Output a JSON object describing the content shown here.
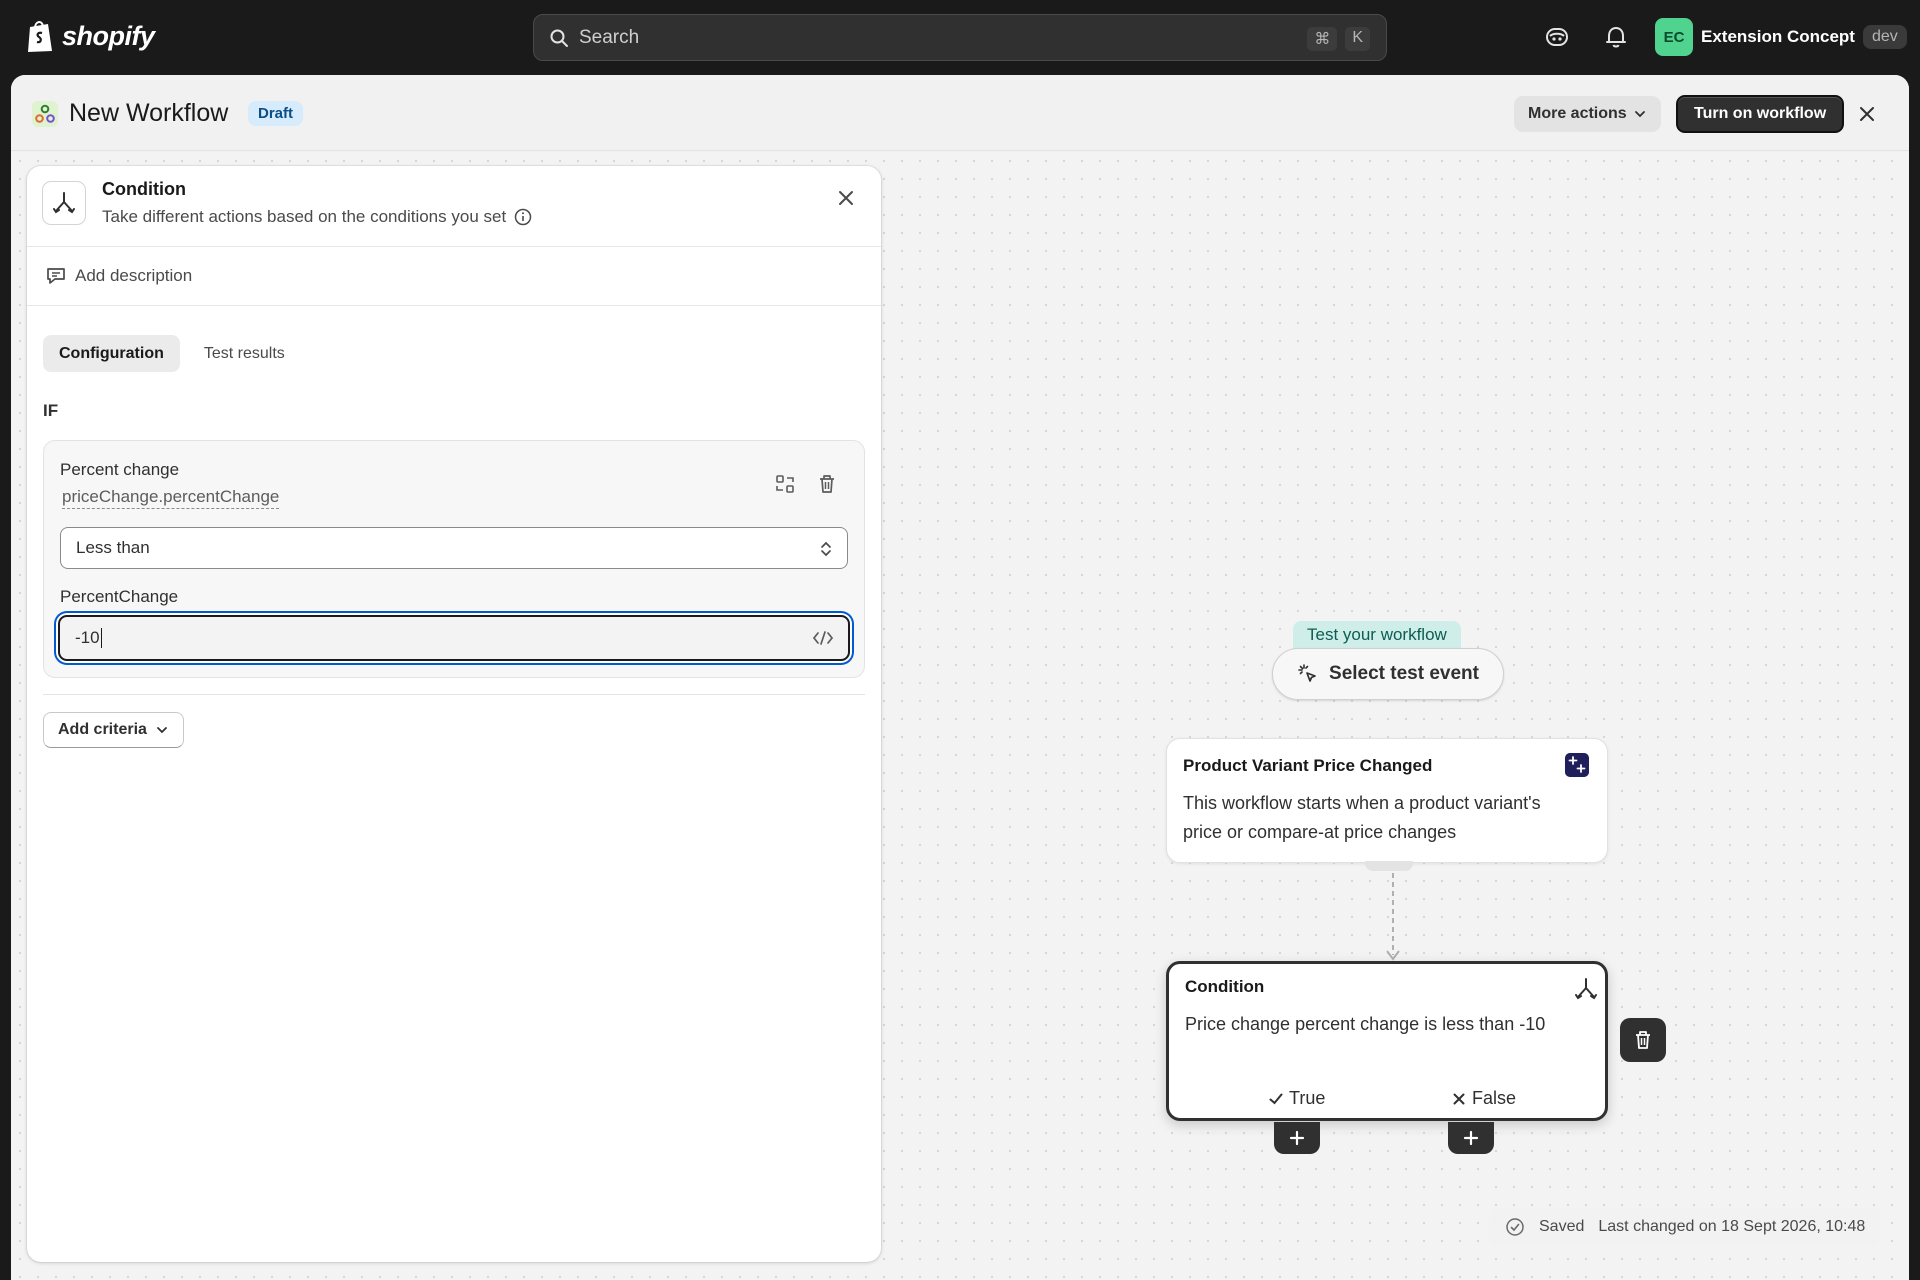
{
  "topbar": {
    "brand": "shopify",
    "search_placeholder": "Search",
    "shortcut_cmd": "⌘",
    "shortcut_key": "K",
    "store_initials": "EC",
    "store_name": "Extension Concept",
    "store_env": "dev"
  },
  "header": {
    "title": "New Workflow",
    "status_badge": "Draft",
    "more_actions_label": "More actions",
    "turn_on_label": "Turn on workflow"
  },
  "panel": {
    "title": "Condition",
    "subtitle": "Take different actions based on the conditions you set",
    "add_description": "Add description",
    "tabs": [
      {
        "label": "Configuration",
        "active": true
      },
      {
        "label": "Test results",
        "active": false
      }
    ],
    "if_label": "IF",
    "criteria": {
      "name": "Percent change",
      "path": "priceChange.percentChange",
      "operator": "Less than",
      "field_label": "PercentChange",
      "value": "-10"
    },
    "add_criteria_label": "Add criteria"
  },
  "canvas": {
    "test_tag": "Test your workflow",
    "test_button": "Select test event",
    "trigger": {
      "title": "Product Variant Price Changed",
      "text": "This workflow starts when a product variant's price or compare-at price changes"
    },
    "condition": {
      "title": "Condition",
      "text": "Price change percent change is less than -10",
      "true_label": "True",
      "false_label": "False"
    },
    "saved_label": "Saved",
    "last_changed": "Last changed on 18 Sept 2026, 10:48"
  },
  "colors": {
    "accent_focus": "#005bd3",
    "avatar": "#4fd38f",
    "draft_badge": "#d6ebfb",
    "test_tag": "#cfeee9",
    "trigger_icon": "#1f1f5c"
  },
  "icons": [
    "shopify-bag-icon",
    "search-icon",
    "sidekick-icon",
    "bell-icon",
    "flow-app-icon",
    "chevron-down-icon",
    "close-icon",
    "condition-branch-icon",
    "info-icon",
    "comment-icon",
    "swap-icon",
    "trash-icon",
    "select-chevron-icon",
    "code-icon",
    "pointer-sparkle-icon",
    "check-icon",
    "x-icon",
    "plus-icon",
    "check-circle-icon"
  ]
}
